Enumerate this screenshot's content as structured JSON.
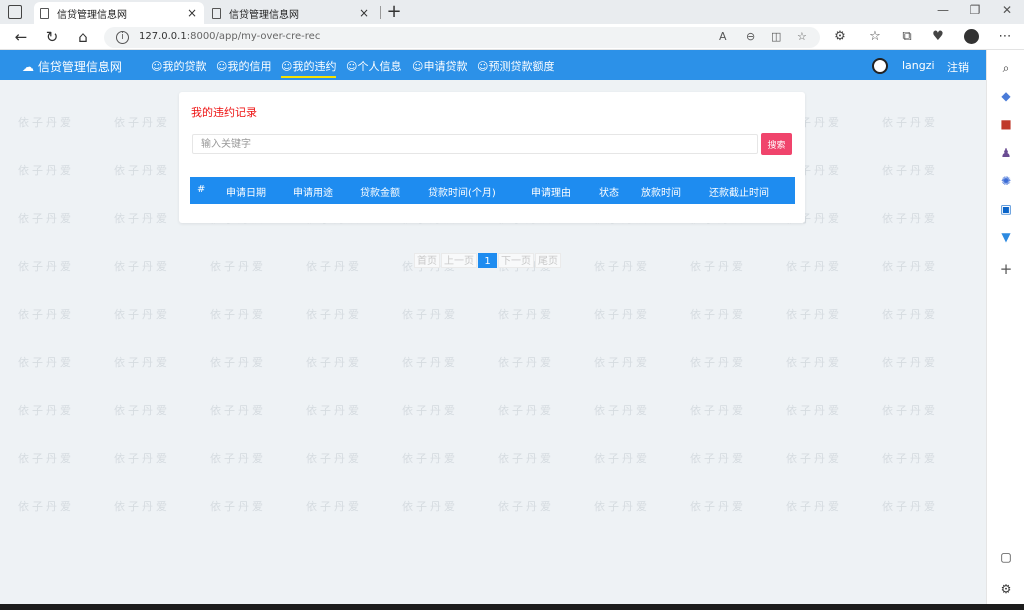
{
  "browser": {
    "tabs": [
      {
        "title": "信贷管理信息网",
        "active": true
      },
      {
        "title": "信贷管理信息网",
        "active": false
      }
    ],
    "close_glyph": "×",
    "new_tab_glyph": "+",
    "url_host": "127.0.0.1",
    "url_path": ":8000/app/my-over-cre-rec",
    "window_controls": [
      "—",
      "❐",
      "✕"
    ]
  },
  "nav": {
    "brand": "信贷管理信息网",
    "items": [
      {
        "label": "我的贷款",
        "active": false
      },
      {
        "label": "我的信用",
        "active": false
      },
      {
        "label": "我的违约",
        "active": true
      },
      {
        "label": "个人信息",
        "active": false
      },
      {
        "label": "申请贷款",
        "active": false
      },
      {
        "label": "预测贷款额度",
        "active": false
      }
    ],
    "username": "langzi",
    "logout": "注销"
  },
  "card": {
    "title": "我的违约记录",
    "search_placeholder": "输入关键字",
    "search_button": "搜索",
    "columns": [
      "#",
      "申请日期",
      "申请用途",
      "贷款金额",
      "贷款时间(个月)",
      "申请理由",
      "状态",
      "放款时间",
      "还款截止时间"
    ],
    "rows": []
  },
  "pager": {
    "first": "首页",
    "prev": "上一页",
    "current": "1",
    "next": "下一页",
    "last": "尾页"
  },
  "watermark_text": "依子丹爱",
  "colors": {
    "nav_bg": "#2c91e8",
    "table_head": "#1e8cf0",
    "search_button": "#f0446c",
    "title_red": "#e11111",
    "active_underline": "#f5e100"
  }
}
